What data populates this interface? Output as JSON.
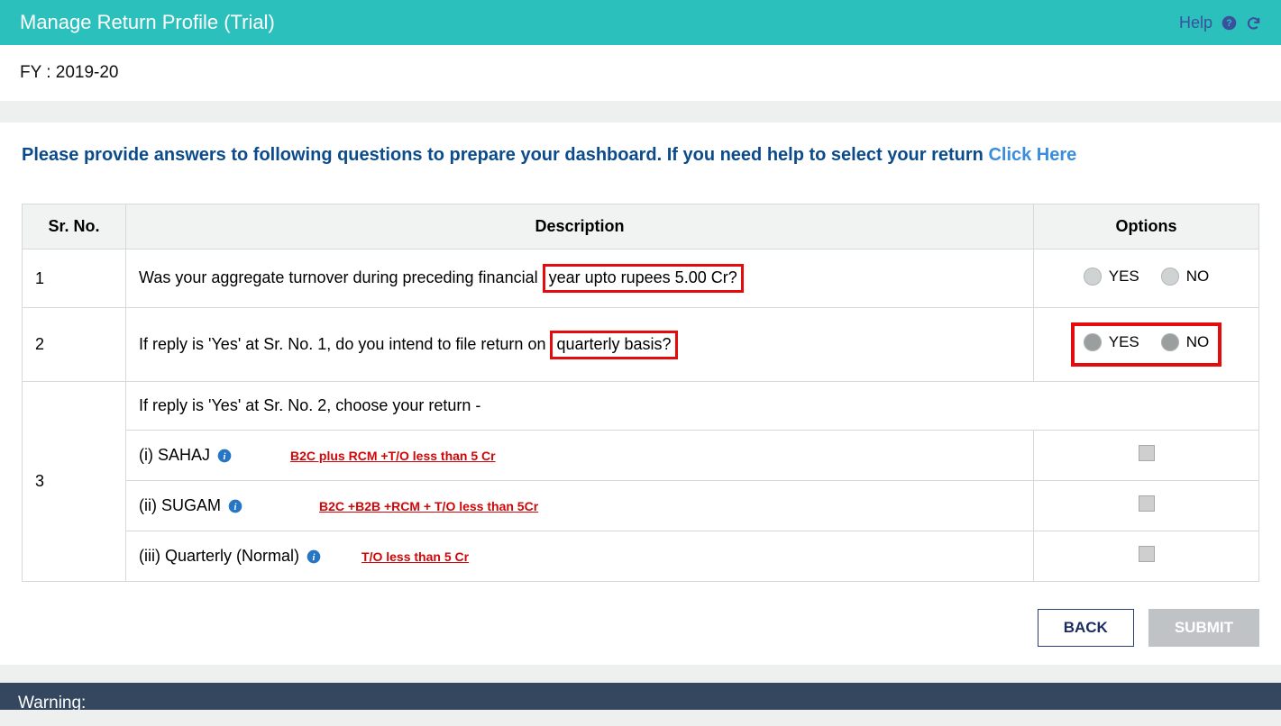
{
  "header": {
    "title": "Manage Return Profile (Trial)",
    "help_label": "Help"
  },
  "fy_label": "FY : 2019-20",
  "instruction_prefix": "Please provide answers to following questions to prepare your dashboard. If you need help to select your return ",
  "instruction_link": "Click Here",
  "table": {
    "headers": {
      "sr": "Sr. No.",
      "desc": "Description",
      "opt": "Options"
    },
    "row1": {
      "sr": "1",
      "desc_prefix": "Was your aggregate turnover during preceding financial ",
      "desc_highlight": "year upto rupees 5.00 Cr?",
      "yes": "YES",
      "no": "NO"
    },
    "row2": {
      "sr": "2",
      "desc_prefix": "If reply is 'Yes' at Sr. No. 1, do you intend to file return on ",
      "desc_highlight": "quarterly basis?",
      "yes": "YES",
      "no": "NO"
    },
    "row3": {
      "sr": "3",
      "intro": "If reply is 'Yes' at Sr. No. 2, choose your return -",
      "opt1_label": "(i) SAHAJ",
      "opt1_note": "B2C plus RCM +T/O less than 5 Cr",
      "opt2_label": "(ii) SUGAM",
      "opt2_note": "B2C +B2B +RCM + T/O less than 5Cr",
      "opt3_label": "(iii) Quarterly (Normal)",
      "opt3_note": "T/O less than 5 Cr"
    }
  },
  "buttons": {
    "back": "BACK",
    "submit": "SUBMIT"
  },
  "warning_label": "Warning:"
}
